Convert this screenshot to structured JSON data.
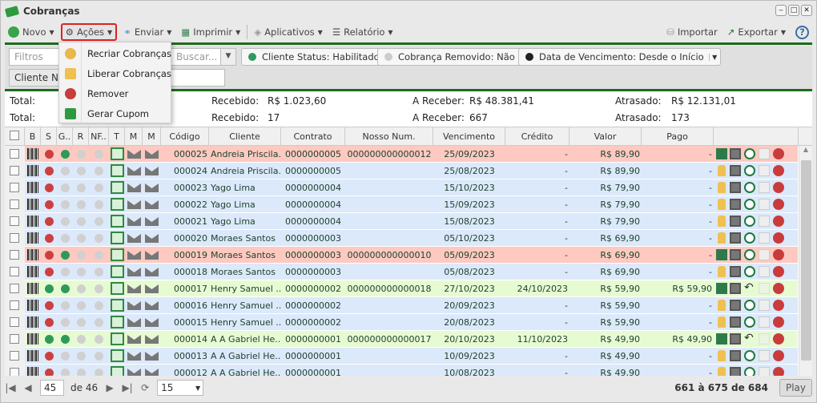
{
  "window": {
    "title": "Cobranças"
  },
  "toolbar": {
    "novo": "Novo",
    "acoes": "Ações",
    "enviar": "Enviar",
    "imprimir": "Imprimir",
    "aplicativos": "Aplicativos",
    "relatorio": "Relatório",
    "importar": "Importar",
    "exportar": "Exportar",
    "help": "?"
  },
  "actions_menu": [
    {
      "label": "Recriar Cobranças",
      "icon": "refresh-icon"
    },
    {
      "label": "Liberar Cobranças",
      "icon": "lock-icon"
    },
    {
      "label": "Remover",
      "icon": "remove-icon"
    },
    {
      "label": "Gerar Cupom",
      "icon": "money-icon"
    }
  ],
  "filters": {
    "placeholder": "Filtros",
    "search_placeholder": "Buscar...",
    "cliente_nome": "Cliente Nome",
    "chips": [
      {
        "label": "Cliente Status: Habilitado",
        "color": "#2e9a5a"
      },
      {
        "label": "Cobrança Removido: Não",
        "color": "#cccccc"
      },
      {
        "label": "Data de Vencimento: Desde o Início",
        "color": "#222222"
      }
    ]
  },
  "summary": {
    "row1": {
      "total_label": "Total:",
      "recebido_label": "Recebido:",
      "recebido": "R$ 1.023,60",
      "areceber_label": "A Receber:",
      "areceber": "R$ 48.381,41",
      "atrasado_label": "Atrasado:",
      "atrasado": "R$ 12.131,01"
    },
    "row2": {
      "total_label": "Total:",
      "recebido_label": "Recebido:",
      "recebido": "17",
      "areceber_label": "A Receber:",
      "areceber": "667",
      "atrasado_label": "Atrasado:",
      "atrasado": "173"
    }
  },
  "columns": [
    "B",
    "S",
    "G..",
    "R",
    "NF..",
    "T",
    "M",
    "M",
    "Código",
    "Cliente",
    "Contrato",
    "Nosso Num.",
    "Vencimento",
    "Crédito",
    "Valor",
    "Pago"
  ],
  "colors": {
    "overdue_paid_gen": "#fdc9c0",
    "open": "#dce9fb",
    "paid": "#e7fbd3",
    "red": "#cc4040",
    "green": "#2e9a5a",
    "gray": "#d0d0d0"
  },
  "rows": [
    {
      "codigo": "000025",
      "cliente": "Andreia Priscila...",
      "contrato": "0000000005",
      "nosso": "000000000000012",
      "venc": "25/09/2023",
      "credito": "-",
      "valor": "R$ 89,90",
      "pago": "-",
      "state": "pink",
      "s": "red",
      "g": "green"
    },
    {
      "codigo": "000024",
      "cliente": "Andreia Priscila...",
      "contrato": "0000000005",
      "nosso": "",
      "venc": "25/08/2023",
      "credito": "-",
      "valor": "R$ 89,90",
      "pago": "-",
      "state": "blue",
      "s": "red",
      "g": "gray"
    },
    {
      "codigo": "000023",
      "cliente": "Yago Lima",
      "contrato": "0000000004",
      "nosso": "",
      "venc": "15/10/2023",
      "credito": "-",
      "valor": "R$ 79,90",
      "pago": "-",
      "state": "blue",
      "s": "red",
      "g": "gray"
    },
    {
      "codigo": "000022",
      "cliente": "Yago Lima",
      "contrato": "0000000004",
      "nosso": "",
      "venc": "15/09/2023",
      "credito": "-",
      "valor": "R$ 79,90",
      "pago": "-",
      "state": "blue",
      "s": "red",
      "g": "gray"
    },
    {
      "codigo": "000021",
      "cliente": "Yago Lima",
      "contrato": "0000000004",
      "nosso": "",
      "venc": "15/08/2023",
      "credito": "-",
      "valor": "R$ 79,90",
      "pago": "-",
      "state": "blue",
      "s": "red",
      "g": "gray"
    },
    {
      "codigo": "000020",
      "cliente": "Moraes Santos",
      "contrato": "0000000003",
      "nosso": "",
      "venc": "05/10/2023",
      "credito": "-",
      "valor": "R$ 69,90",
      "pago": "-",
      "state": "blue",
      "s": "red",
      "g": "gray"
    },
    {
      "codigo": "000019",
      "cliente": "Moraes Santos",
      "contrato": "0000000003",
      "nosso": "000000000000010",
      "venc": "05/09/2023",
      "credito": "-",
      "valor": "R$ 69,90",
      "pago": "-",
      "state": "pink",
      "s": "red",
      "g": "green"
    },
    {
      "codigo": "000018",
      "cliente": "Moraes Santos",
      "contrato": "0000000003",
      "nosso": "",
      "venc": "05/08/2023",
      "credito": "-",
      "valor": "R$ 69,90",
      "pago": "-",
      "state": "blue",
      "s": "red",
      "g": "gray"
    },
    {
      "codigo": "000017",
      "cliente": "Henry Samuel ...",
      "contrato": "0000000002",
      "nosso": "000000000000018",
      "venc": "27/10/2023",
      "credito": "24/10/2023",
      "valor": "R$ 59,90",
      "pago": "R$ 59,90",
      "state": "green",
      "s": "green",
      "g": "green"
    },
    {
      "codigo": "000016",
      "cliente": "Henry Samuel ...",
      "contrato": "0000000002",
      "nosso": "",
      "venc": "20/09/2023",
      "credito": "-",
      "valor": "R$ 59,90",
      "pago": "-",
      "state": "blue",
      "s": "red",
      "g": "gray"
    },
    {
      "codigo": "000015",
      "cliente": "Henry Samuel ...",
      "contrato": "0000000002",
      "nosso": "",
      "venc": "20/08/2023",
      "credito": "-",
      "valor": "R$ 59,90",
      "pago": "-",
      "state": "blue",
      "s": "red",
      "g": "gray"
    },
    {
      "codigo": "000014",
      "cliente": "A A Gabriel He...",
      "contrato": "0000000001",
      "nosso": "000000000000017",
      "venc": "20/10/2023",
      "credito": "11/10/2023",
      "valor": "R$ 49,90",
      "pago": "R$ 49,90",
      "state": "green",
      "s": "green",
      "g": "green"
    },
    {
      "codigo": "000013",
      "cliente": "A A Gabriel He...",
      "contrato": "0000000001",
      "nosso": "",
      "venc": "10/09/2023",
      "credito": "-",
      "valor": "R$ 49,90",
      "pago": "-",
      "state": "blue",
      "s": "red",
      "g": "gray"
    },
    {
      "codigo": "000012",
      "cliente": "A A Gabriel He...",
      "contrato": "0000000001",
      "nosso": "",
      "venc": "10/08/2023",
      "credito": "-",
      "valor": "R$ 49,90",
      "pago": "-",
      "state": "blue",
      "s": "red",
      "g": "gray"
    }
  ],
  "pager": {
    "page": "45",
    "of": "de 46",
    "page_size": "15",
    "range": "661 à 675 de 684",
    "play": "Play"
  }
}
